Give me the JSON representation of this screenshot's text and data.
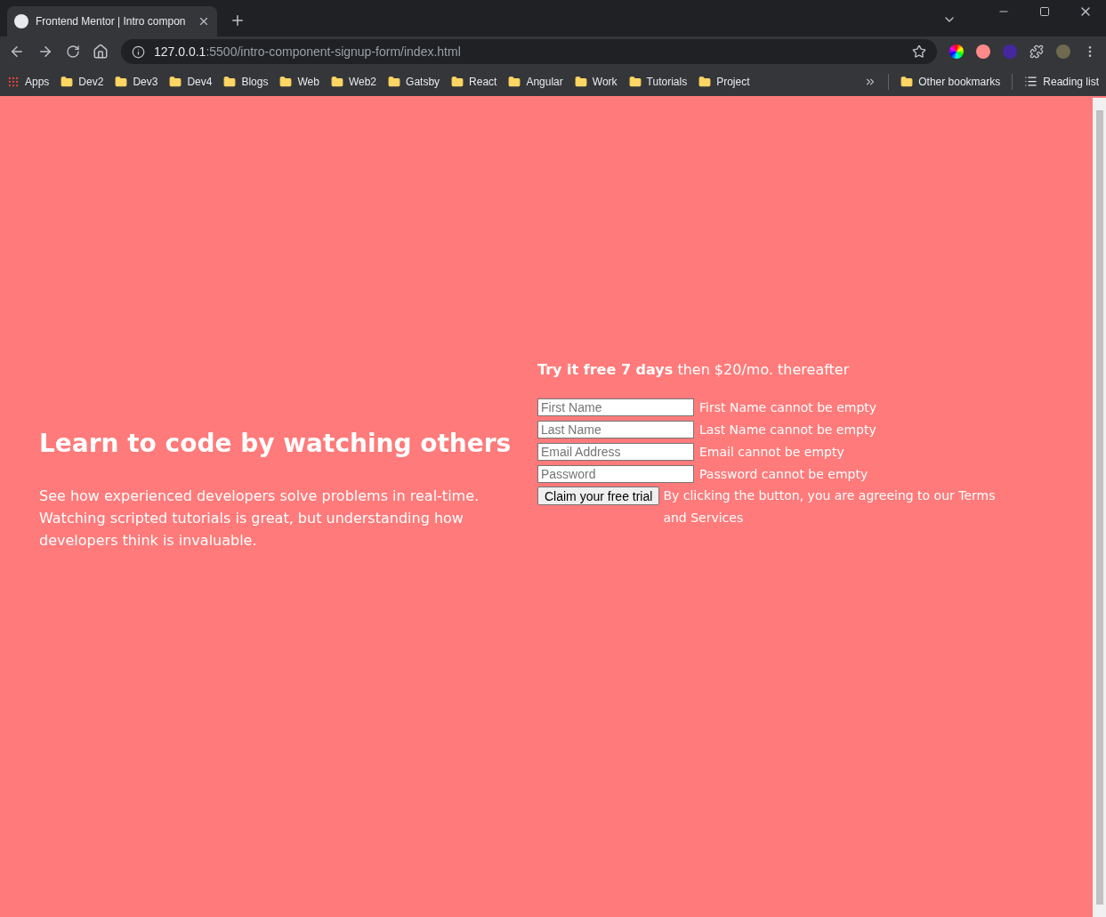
{
  "browser": {
    "tab": {
      "title": "Frontend Mentor | Intro compon"
    },
    "address": {
      "host": "127.0.0.1",
      "path": ":5500/intro-component-signup-form/index.html"
    },
    "bookmarks": {
      "apps": "Apps",
      "folders": [
        "Dev2",
        "Dev3",
        "Dev4",
        "Blogs",
        "Web",
        "Web2",
        "Gatsby",
        "React",
        "Angular",
        "Work",
        "Tutorials",
        "Project"
      ],
      "other": "Other bookmarks",
      "reading_list": "Reading list"
    }
  },
  "page": {
    "heading": "Learn to code by watching others",
    "description": "See how experienced developers solve problems in real-time. Watching scripted tutorials is great, but understanding how developers think is invaluable.",
    "offer": "**Try it free 7 days** then $20/mo. thereafter",
    "fields": [
      {
        "placeholder": "First Name",
        "error": "First Name cannot be empty"
      },
      {
        "placeholder": "Last Name",
        "error": "Last Name cannot be empty"
      },
      {
        "placeholder": "Email Address",
        "error": "Email cannot be empty"
      },
      {
        "placeholder": "Password",
        "error": "Password cannot be empty"
      }
    ],
    "button": "Claim your free trial",
    "terms": "By clicking the button, you are agreeing to our Terms and Services"
  }
}
